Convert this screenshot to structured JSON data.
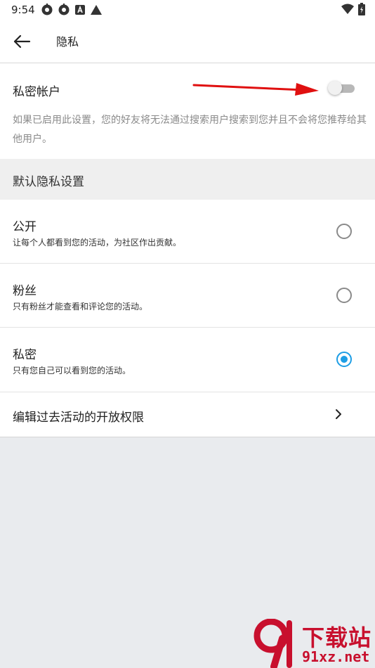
{
  "status_bar": {
    "time": "9:54",
    "left_icons": [
      "settings-gear-icon",
      "settings-gear-icon",
      "android-a-icon",
      "triangle-icon"
    ],
    "right_icons": [
      "wifi-icon",
      "battery-charging-icon"
    ]
  },
  "app_bar": {
    "back_icon": "arrow-left-icon",
    "title": "隐私"
  },
  "private_account": {
    "label": "私密帐户",
    "toggle_on": false,
    "description": "如果已启用此设置，您的好友将无法通过搜索用户搜索到您并且不会将您推荐给其他用户。"
  },
  "default_privacy": {
    "header": "默认隐私设置",
    "options": [
      {
        "title": "公开",
        "description": "让每个人都看到您的活动，为社区作出贡献。",
        "selected": false
      },
      {
        "title": "粉丝",
        "description": "只有粉丝才能查看和评论您的活动。",
        "selected": false
      },
      {
        "title": "私密",
        "description": "只有您自己可以看到您的活动。",
        "selected": true
      }
    ]
  },
  "edit_past": {
    "label": "编辑过去活动的开放权限",
    "chevron_icon": "chevron-right-icon"
  },
  "watermark": {
    "title": "下载站",
    "domain": "91xz.net"
  },
  "colors": {
    "accent": "#1e9ee5",
    "annotation_arrow": "#e01010",
    "watermark": "#c8102e"
  }
}
